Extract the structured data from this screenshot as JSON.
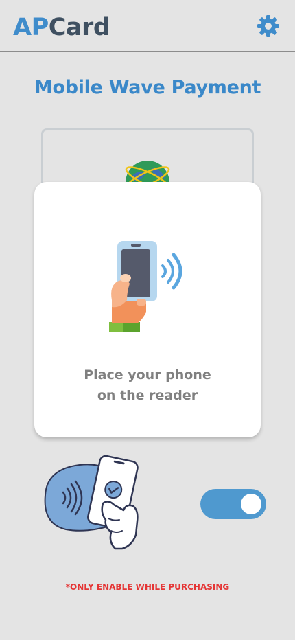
{
  "app": {
    "logo_prefix": "AP",
    "logo_suffix": "Card",
    "brand_color": "#3f8ccb",
    "settings_icon": "gear-icon"
  },
  "main": {
    "title": "Mobile Wave Payment"
  },
  "modal": {
    "line1": "Place your phone",
    "line2": "on the reader",
    "illustration": "phone-tap-icon"
  },
  "controls": {
    "illustration": "contactless-pay-icon",
    "toggle_on": true,
    "toggle_color": "#4f99cf"
  },
  "footer": {
    "note": "*ONLY ENABLE WHILE PURCHASING",
    "note_color": "#e53535"
  }
}
